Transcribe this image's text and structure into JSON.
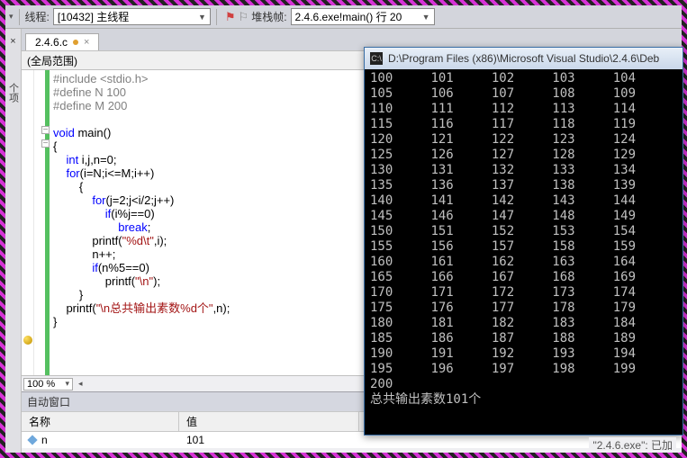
{
  "toolbar": {
    "thread_label": "线程:",
    "thread_value": "[10432] 主线程",
    "stack_label": "堆栈帧:",
    "stack_value": "2.4.6.exe!main() 行 20"
  },
  "tab": {
    "name": "2.4.6.c"
  },
  "scope": {
    "global": "(全局范围)"
  },
  "left": {
    "label": "个项",
    "close": "×"
  },
  "code": {
    "l1": "#include <stdio.h>",
    "l2": "#define N 100",
    "l3": "#define M 200",
    "l4": "void main()",
    "l5": "{",
    "l6": "    int i,j,n=0;",
    "l7": "    for(i=N;i<=M;i++)",
    "l8": "        {",
    "l9": "            for(j=2;j<i/2;j++)",
    "l10": "                if(i%j==0)",
    "l11": "                    break;",
    "l12": "            printf(\"%d\\t\",i);",
    "l13": "            n++;",
    "l14": "            if(n%5==0)",
    "l15": "                printf(\"\\n\");",
    "l16": "        }",
    "l17": "    printf(\"\\n总共输出素数%d个\",n);",
    "l18": "}"
  },
  "zoom": {
    "value": "100 %"
  },
  "auto": {
    "title": "自动窗口",
    "col_name": "名称",
    "col_value": "值",
    "var": "n",
    "val": "101"
  },
  "console": {
    "title": "D:\\Program Files (x86)\\Microsoft Visual Studio\\2.4.6\\Deb",
    "body": "100\t101\t102\t103\t104\n105\t106\t107\t108\t109\n110\t111\t112\t113\t114\n115\t116\t117\t118\t119\n120\t121\t122\t123\t124\n125\t126\t127\t128\t129\n130\t131\t132\t133\t134\n135\t136\t137\t138\t139\n140\t141\t142\t143\t144\n145\t146\t147\t148\t149\n150\t151\t152\t153\t154\n155\t156\t157\t158\t159\n160\t161\t162\t163\t164\n165\t166\t167\t168\t169\n170\t171\t172\t173\t174\n175\t176\t177\t178\t179\n180\t181\t182\t183\t184\n185\t186\t187\t188\t189\n190\t191\t192\t193\t194\n195\t196\t197\t198\t199\n200\n总共输出素数101个"
  },
  "status": {
    "text": "\"2.4.6.exe\": 已加"
  }
}
